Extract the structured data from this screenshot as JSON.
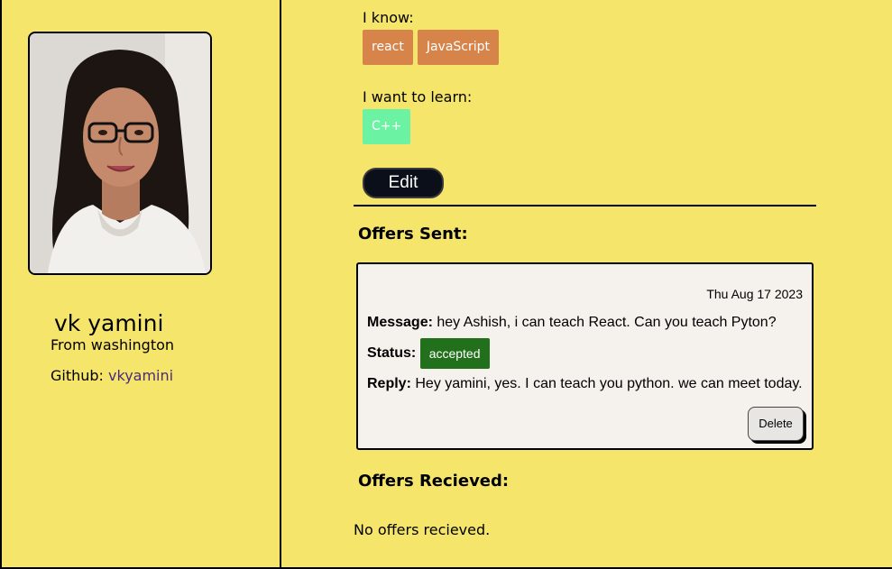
{
  "profile": {
    "name": "vk yamini",
    "location": "From washington",
    "github_label": "Github: ",
    "github_handle": "vkyamini"
  },
  "skills": {
    "know_label": "I know:",
    "known": [
      "react",
      "JavaScript"
    ],
    "learn_label": "I want to learn:",
    "learn": [
      "C++"
    ]
  },
  "edit_label": "Edit",
  "offers_sent": {
    "title": "Offers Sent:",
    "items": [
      {
        "date": "Thu Aug 17 2023",
        "message_label": "Message:",
        "message": "hey Ashish, i can teach React. Can you teach Pyton?",
        "status_label": "Status:",
        "status": "accepted",
        "reply_label": "Reply:",
        "reply": "Hey yamini, yes. I can teach you python. we can meet today.",
        "delete_label": "Delete"
      }
    ]
  },
  "offers_received": {
    "title": "Offers Recieved:",
    "empty_text": "No offers recieved."
  },
  "colors": {
    "background": "#f5e56b",
    "known_skill": "#d6844a",
    "learn_skill": "#6cf2a3",
    "status_accepted": "#23701c",
    "link": "#4b2a7e"
  }
}
